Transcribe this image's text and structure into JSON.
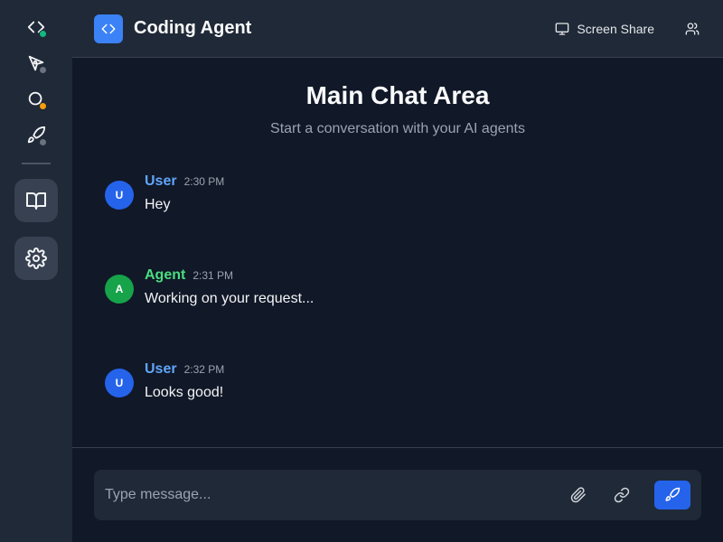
{
  "app": {
    "title": "Coding Agent",
    "logo_icon": "code-brackets-icon",
    "accent_color": "#3b82f6"
  },
  "sidebar": {
    "agents": [
      {
        "icon": "code-brackets-icon",
        "status": "online",
        "status_color": "#10b981"
      },
      {
        "icon": "pen-tool-icon",
        "status": "offline",
        "status_color": "#6b7280"
      },
      {
        "icon": "search-icon",
        "status": "busy",
        "status_color": "#f59e0b"
      },
      {
        "icon": "rocket-icon",
        "status": "offline",
        "status_color": "#6b7280"
      }
    ],
    "buttons": [
      {
        "icon": "book-icon"
      },
      {
        "icon": "gear-icon"
      }
    ]
  },
  "header": {
    "screen_share_label": "Screen Share",
    "screen_share_icon": "monitor-icon",
    "users_icon": "users-icon"
  },
  "chat": {
    "heading": "Main Chat Area",
    "subheading": "Start a conversation with your AI agents",
    "messages": [
      {
        "avatar": "U",
        "author": "User",
        "time": "2:30 PM",
        "text": "Hey",
        "author_color": "#60a5fa",
        "avatar_color": "#2563eb"
      },
      {
        "avatar": "A",
        "author": "Agent",
        "time": "2:31 PM",
        "text": "Working on your request...",
        "author_color": "#4ade80",
        "avatar_color": "#16a34a"
      },
      {
        "avatar": "U",
        "author": "User",
        "time": "2:32 PM",
        "text": "Looks good!",
        "author_color": "#60a5fa",
        "avatar_color": "#2563eb"
      }
    ]
  },
  "composer": {
    "placeholder": "Type message...",
    "value": "",
    "attach_icon": "paperclip-icon",
    "link_icon": "link-icon",
    "send_icon": "rocket-icon"
  }
}
